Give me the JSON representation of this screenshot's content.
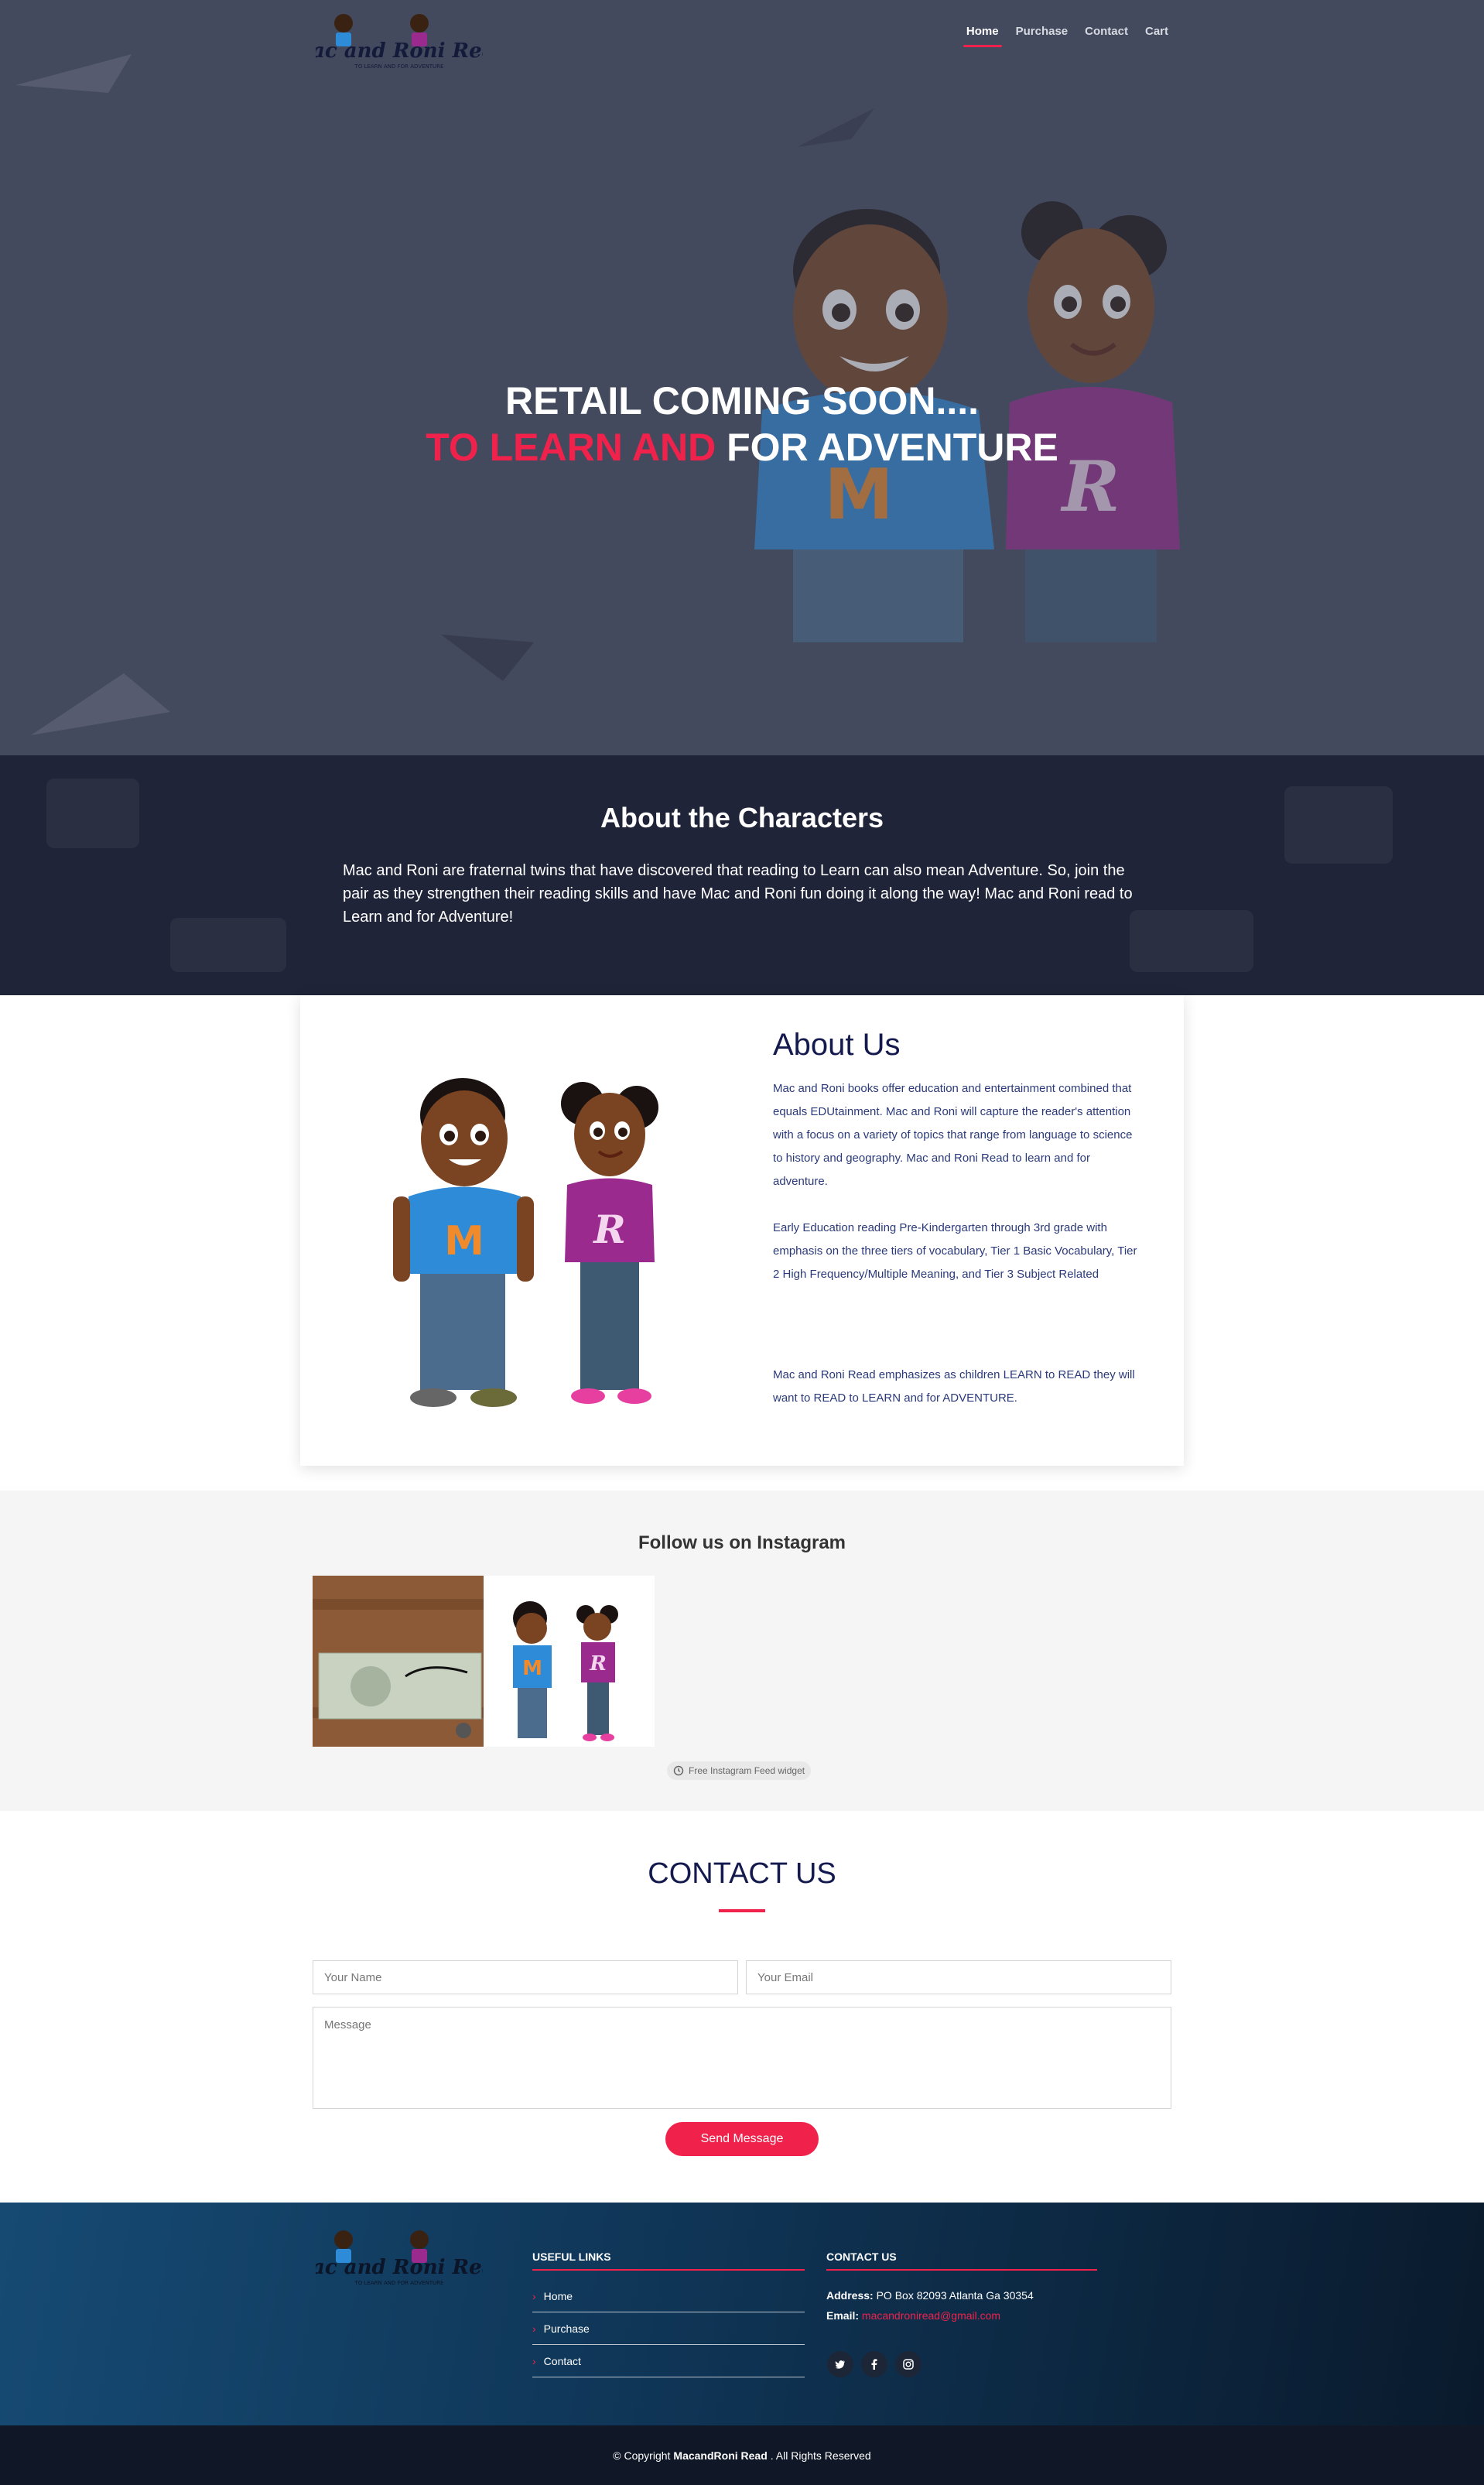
{
  "brand": {
    "logo_text": "Mac and Roni Read",
    "logo_tagline": "To Learn and for Adventure"
  },
  "nav": [
    {
      "label": "Home",
      "active": true
    },
    {
      "label": "Purchase",
      "active": false
    },
    {
      "label": "Contact",
      "active": false
    },
    {
      "label": "Cart",
      "active": false
    }
  ],
  "hero": {
    "line1": "RETAIL COMING SOON....",
    "line2_accent": "TO LEARN AND",
    "line2_rest": "FOR ADVENTURE"
  },
  "characters": {
    "title": "About the Characters",
    "text": "Mac and Roni are fraternal twins that have discovered that reading to Learn can also mean Adventure. So, join the pair as they strengthen their reading skills and have Mac and Roni fun doing it along the way! Mac and Roni read to Learn and for Adventure!"
  },
  "about": {
    "title": "About Us",
    "para1": "Mac and Roni books offer education and entertainment combined that equals EDUtainment. Mac and Roni will capture the reader's attention with a focus on a variety of topics that range from language to science to history and geography. Mac and Roni Read to learn and for adventure.",
    "para2": "Early Education reading Pre-Kindergarten through 3rd grade with emphasis on the three tiers of vocabulary, Tier 1 Basic Vocabulary, Tier 2 High Frequency/Multiple Meaning, and Tier 3 Subject Related",
    "para3": "Mac and Roni Read emphasizes as children LEARN to READ they will want to READ to LEARN and for ADVENTURE."
  },
  "instagram": {
    "title": "Follow us on Instagram",
    "widget_label": "Free Instagram Feed widget"
  },
  "contact": {
    "title": "CONTACT US",
    "name_placeholder": "Your Name",
    "email_placeholder": "Your Email",
    "message_placeholder": "Message",
    "send_label": "Send Message"
  },
  "footer": {
    "links_title": "USEFUL LINKS",
    "links": [
      "Home",
      "Purchase",
      "Contact"
    ],
    "contact_title": "CONTACT US",
    "address_label": "Address:",
    "address": "PO Box 82093 Atlanta Ga 30354",
    "email_label": "Email:",
    "email": "macandroniread@gmail.com",
    "copyright_prefix": "© Copyright",
    "copyright_brand": "MacandRoni Read",
    "copyright_suffix": ". All Rights Reserved"
  },
  "colors": {
    "accent": "#f0224b",
    "navy": "#141a4d",
    "hero_bg": "#444a5e"
  }
}
